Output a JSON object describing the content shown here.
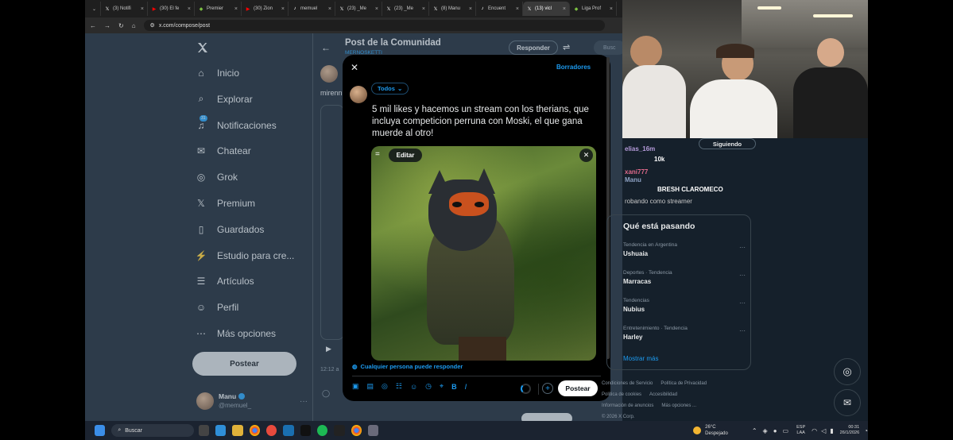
{
  "browser": {
    "tabs": [
      {
        "label": "(3) Notifi",
        "icon": "x-icon",
        "color": "#ffffff"
      },
      {
        "label": "(30) El fe",
        "icon": "youtube-icon",
        "color": "#ff0000"
      },
      {
        "label": "Premier",
        "icon": "league-icon",
        "color": "#7cc242"
      },
      {
        "label": "(30) Zion",
        "icon": "youtube-icon",
        "color": "#ff0000"
      },
      {
        "label": "memuel",
        "icon": "tiktok-icon",
        "color": "#ffffff"
      },
      {
        "label": "(23) _Me",
        "icon": "x-icon",
        "color": "#ffffff"
      },
      {
        "label": "(23) _Me",
        "icon": "x-icon",
        "color": "#ffffff"
      },
      {
        "label": "(8) Manu",
        "icon": "x-icon",
        "color": "#ffffff"
      },
      {
        "label": "Encuent",
        "icon": "tiktok-icon",
        "color": "#ffffff"
      },
      {
        "label": "(13) vicl",
        "icon": "x-icon",
        "color": "#ffffff"
      },
      {
        "label": "Liga Prof",
        "icon": "league-icon",
        "color": "#7cc242"
      }
    ],
    "url": "x.com/compose/post"
  },
  "sidebar": {
    "items": [
      {
        "label": "Inicio",
        "icon": "home-icon"
      },
      {
        "label": "Explorar",
        "icon": "search-icon"
      },
      {
        "label": "Notificaciones",
        "icon": "bell-icon",
        "badge": "31"
      },
      {
        "label": "Chatear",
        "icon": "mail-icon"
      },
      {
        "label": "Grok",
        "icon": "grok-icon"
      },
      {
        "label": "Premium",
        "icon": "x-icon"
      },
      {
        "label": "Guardados",
        "icon": "bookmark-icon"
      },
      {
        "label": "Estudio para cre...",
        "icon": "studio-icon"
      },
      {
        "label": "Artículos",
        "icon": "articles-icon"
      },
      {
        "label": "Perfil",
        "icon": "profile-icon"
      },
      {
        "label": "Más opciones",
        "icon": "more-icon"
      }
    ],
    "post_button": "Postear",
    "account": {
      "name": "Manu",
      "handle": "@memuel_"
    }
  },
  "center": {
    "title": "Post de la Comunidad",
    "subtitle": "MERNOSKETTI",
    "respond_button": "Responder",
    "preview_text": "mirenn",
    "time_text": "12:12 a"
  },
  "compose": {
    "drafts": "Borradores",
    "audience": "Todos",
    "text": "5 mil likes y hacemos un stream con los therians, que incluya competicion perruna con Moski, el que gana muerde al otro!",
    "edit_label": "Editar",
    "reply_setting": "Cualquier persona puede responder",
    "post_button": "Postear"
  },
  "rightpanel": {
    "search_placeholder": "Busc",
    "follow_button": "Siguiendo",
    "chat": [
      {
        "user": "elias_16m",
        "text": ""
      },
      {
        "user": "",
        "text": "10k"
      },
      {
        "user": "xani777",
        "text": ""
      },
      {
        "user": "Manu",
        "text": "BRESH CLAROMECO"
      },
      {
        "user": "",
        "text": "robando como streamer"
      }
    ],
    "trends_title": "Qué está pasando",
    "trends": [
      {
        "context": "Tendencia en Argentina",
        "name": "Ushuaia"
      },
      {
        "context": "Deportes · Tendencia",
        "name": "Marracas"
      },
      {
        "context": "Tendencias",
        "name": "Nubius"
      },
      {
        "context": "Entretenimiento · Tendencia",
        "name": "Harley"
      }
    ],
    "show_more": "Mostrar más",
    "footer": [
      "Condiciones de Servicio",
      "Política de Privacidad",
      "Política de cookies",
      "Accesibilidad",
      "Información de anuncios",
      "Más opciones ...",
      "© 2026 X Corp."
    ]
  },
  "taskbar": {
    "search": "Buscar",
    "weather_temp": "26°C",
    "weather_desc": "Despejado",
    "lang1": "ESP",
    "lang2": "LAA",
    "time": "00:31",
    "date": "26/1/2026"
  }
}
